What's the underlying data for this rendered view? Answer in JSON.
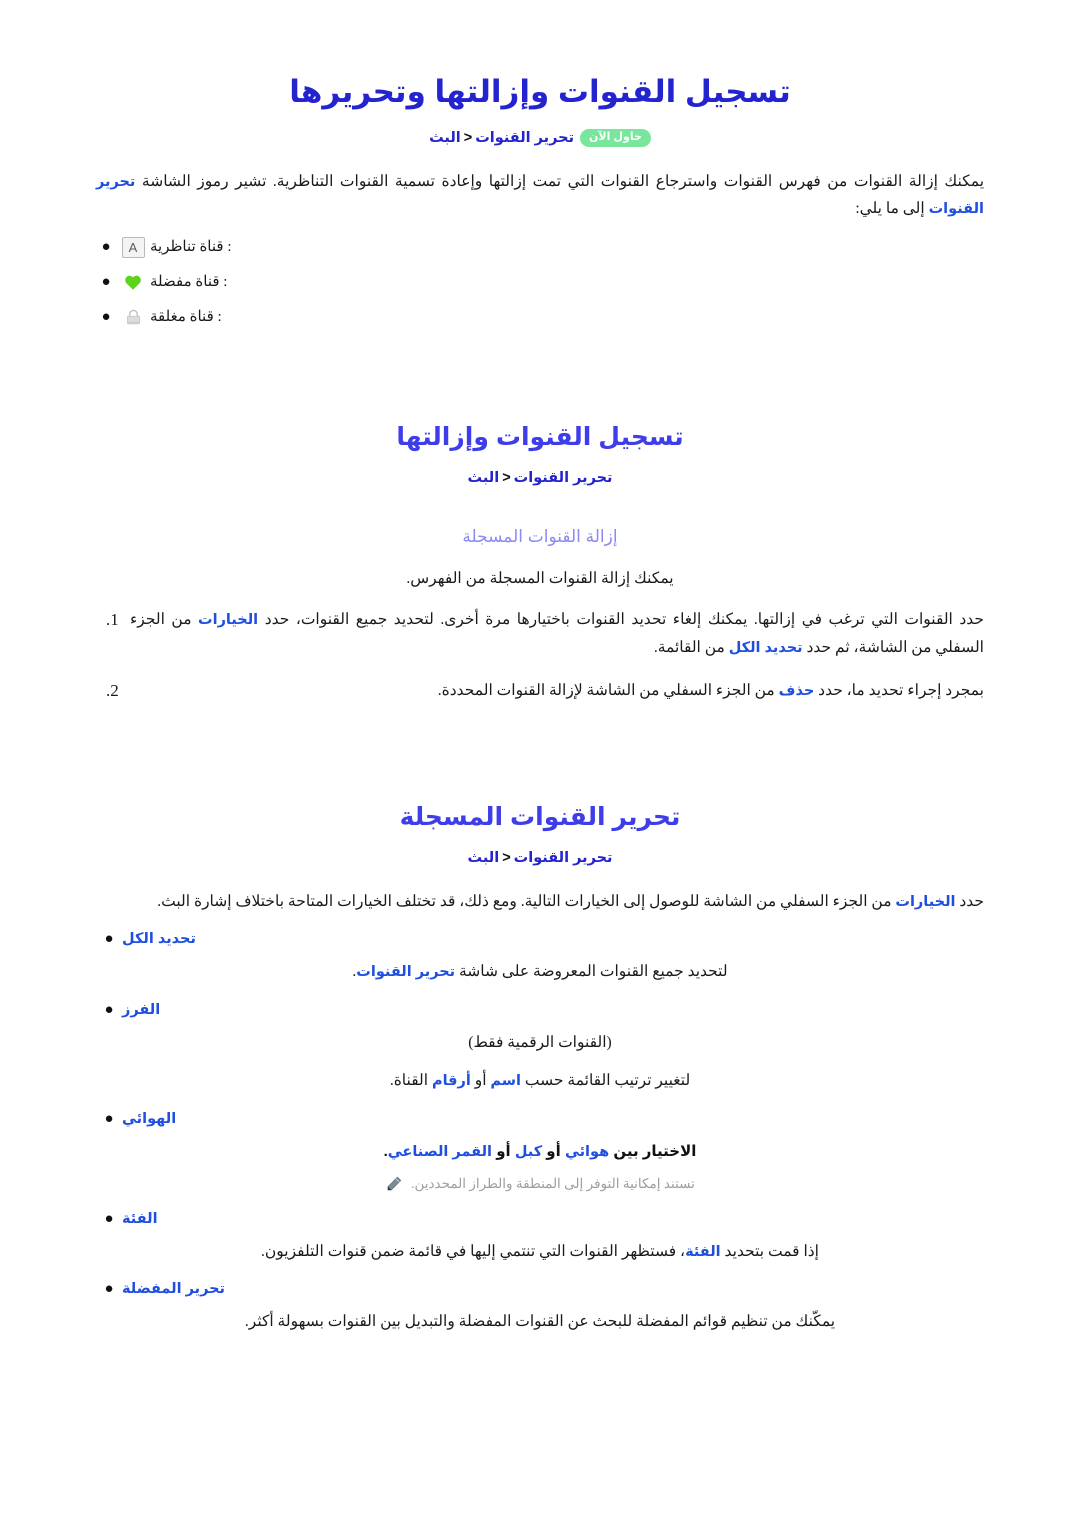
{
  "document": {
    "title": "تسجيل القنوات وإزالتها وتحريرها",
    "breadcrumb": {
      "root": "البث",
      "separator": "<",
      "leaf": "تحرير القنوات",
      "badge": "حاول الآن"
    },
    "intro": {
      "before": "يمكنك إزالة القنوات من فهرس القنوات واسترجاع القنوات التي تمت إزالتها وإعادة تسمية القنوات التناظرية. تشير رموز الشاشة",
      "keyword": "تحرير القنوات",
      "after": "إلى ما يلي:"
    },
    "icon_legend": [
      {
        "icon": "analog-channel-icon",
        "glyph": "A",
        "label": ": قناة تناظرية"
      },
      {
        "icon": "favorite-heart-icon",
        "glyph": "heart",
        "label": ": قناة مفضلة"
      },
      {
        "icon": "locked-padlock-icon",
        "glyph": "lock",
        "label": ": قناة مغلقة"
      }
    ]
  },
  "section_register": {
    "title": "تسجيل القنوات وإزالتها",
    "breadcrumb": {
      "root": "البث",
      "separator": "<",
      "leaf": "تحرير القنوات"
    },
    "subsection": {
      "title": "إزالة القنوات المسجلة",
      "lead": "يمكنك إزالة القنوات المسجلة من الفهرس.",
      "steps": [
        {
          "number": "1",
          "text_1": "حدد القنوات التي ترغب في إزالتها. يمكنك إلغاء تحديد القنوات باختيارها مرة أخرى. لتحديد جميع القنوات، حدد",
          "kw_1": "الخيارات",
          "text_2": "من الجزء السفلي من الشاشة، ثم حدد",
          "kw_2": "تحديد الكل",
          "text_3": "من القائمة."
        },
        {
          "number": "2",
          "text_1": "بمجرد إجراء تحديد ما، حدد",
          "kw_1": "حذف",
          "text_2": "من الجزء السفلي من الشاشة لإزالة القنوات المحددة.",
          "kw_2": "",
          "text_3": ""
        }
      ]
    }
  },
  "section_edit": {
    "title": "تحرير القنوات المسجلة",
    "breadcrumb": {
      "root": "البث",
      "separator": "<",
      "leaf": "تحرير القنوات"
    },
    "lead": {
      "before": "حدد",
      "keyword": "الخيارات",
      "after": "من الجزء السفلي من الشاشة للوصول إلى الخيارات التالية. ومع ذلك، قد تختلف الخيارات المتاحة باختلاف إشارة البث."
    },
    "options": [
      {
        "label": "تحديد الكل",
        "desc_before": "لتحديد جميع القنوات المعروضة على شاشة",
        "desc_keyword": "تحرير القنوات",
        "desc_after": ".",
        "desc_bold": true,
        "paren": "",
        "note": ""
      },
      {
        "label": "الفرز",
        "paren": "(القنوات الرقمية فقط)",
        "desc_before": "لتغيير ترتيب القائمة حسب",
        "desc_keyword": "اسم",
        "desc_middle": "أو",
        "desc_keyword_2": "أرقام",
        "desc_after": "القناة.",
        "note": ""
      },
      {
        "label": "الهوائي",
        "desc_before": "الاختيار بين",
        "desc_keyword": "هوائي",
        "desc_middle": "أو",
        "desc_keyword_2": "كبل",
        "desc_middle_2": "أو",
        "desc_keyword_3": "القمر الصناعي",
        "desc_after": ".",
        "note": "تستند إمكانية التوفر إلى المنطقة والطراز المحددين."
      },
      {
        "label": "الفئة",
        "desc_before": "إذا قمت بتحديد",
        "desc_keyword": "الفئة",
        "desc_after": "، فستظهر القنوات التي تنتمي إليها في قائمة ضمن قنوات التلفزيون.",
        "note": ""
      },
      {
        "label": "تحرير المفضلة",
        "desc_before": "يمكّنك من تنظيم قوائم المفضلة للبحث عن القنوات المفضلة والتبديل بين القنوات بسهولة أكثر.",
        "note": ""
      }
    ]
  },
  "colors": {
    "title_blue": "#2323cf",
    "section_blue": "#3d3dea",
    "sub_periwinkle": "#8a8af0",
    "keyword_blue": "#1f4fe0",
    "badge_green": "#79e79b",
    "note_grey": "#9e9e9e",
    "heart_green": "#5fd21c",
    "lock_grey": "#d8d8d8"
  }
}
